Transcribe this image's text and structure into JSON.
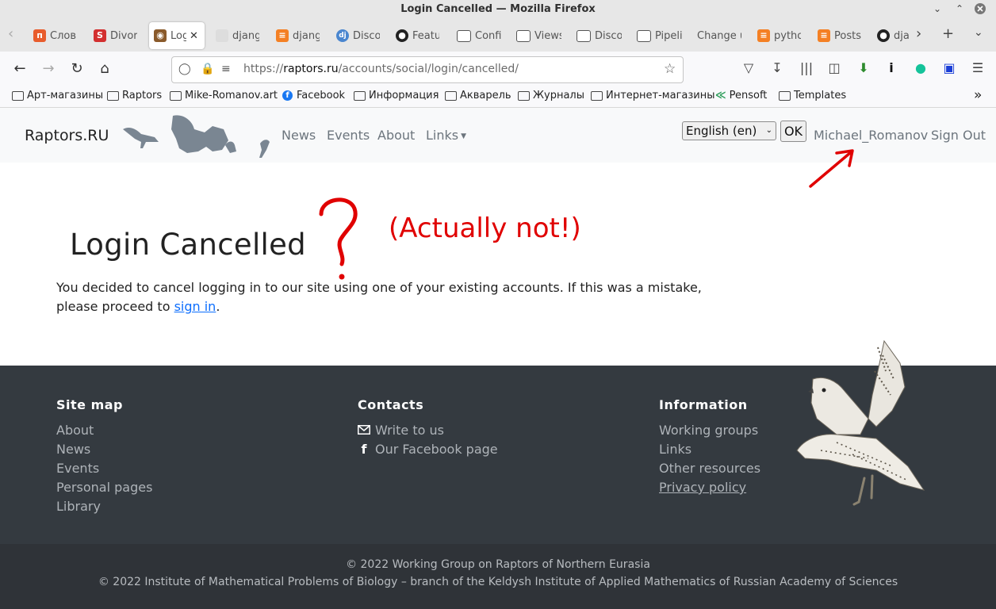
{
  "window": {
    "title": "Login Cancelled — Mozilla Firefox"
  },
  "tabs": [
    {
      "label": "Слов",
      "icon": "p-favicon",
      "color": "#e85c2c"
    },
    {
      "label": "Divor",
      "icon": "s-favicon",
      "color": "#d32f2f"
    },
    {
      "label": "Log",
      "icon": "owl-favicon",
      "color": "#8a5a2b",
      "active": true
    },
    {
      "label": "djang",
      "icon": "cube-favicon",
      "color": "#cccccc"
    },
    {
      "label": "djang",
      "icon": "stackoverflow-icon",
      "color": "#f48024"
    },
    {
      "label": "Disco",
      "icon": "dj-favicon",
      "color": "#4a86cf"
    },
    {
      "label": "Featu",
      "icon": "github-icon",
      "color": "#222222"
    },
    {
      "label": "Confi",
      "icon": "doc-icon",
      "color": "#555555"
    },
    {
      "label": "Views",
      "icon": "doc-icon",
      "color": "#555555"
    },
    {
      "label": "Disco",
      "icon": "doc-icon",
      "color": "#555555"
    },
    {
      "label": "Pipeli",
      "icon": "doc-icon",
      "color": "#555555"
    },
    {
      "label": "Change u",
      "icon": "none",
      "color": "#e7e7e7"
    },
    {
      "label": "pytho",
      "icon": "stackoverflow-icon",
      "color": "#f48024"
    },
    {
      "label": "Posts",
      "icon": "stackoverflow-icon",
      "color": "#f48024"
    },
    {
      "label": "dja",
      "icon": "github-icon",
      "color": "#222222"
    }
  ],
  "url": {
    "prefix": "https://",
    "host": "raptors.ru",
    "path": "/accounts/social/login/cancelled/"
  },
  "bookmarks": [
    {
      "label": "Арт-магазины",
      "icon": "folder-icon"
    },
    {
      "label": "Raptors",
      "icon": "folder-icon"
    },
    {
      "label": "Mike-Romanov.art",
      "icon": "folder-icon"
    },
    {
      "label": "Facebook",
      "icon": "facebook-icon"
    },
    {
      "label": "Информация",
      "icon": "folder-icon"
    },
    {
      "label": "Акварель",
      "icon": "folder-icon"
    },
    {
      "label": "Журналы",
      "icon": "folder-icon"
    },
    {
      "label": "Интернет-магазины",
      "icon": "folder-icon"
    },
    {
      "label": "Pensoft",
      "icon": "pensoft-icon"
    },
    {
      "label": "Templates",
      "icon": "folder-icon"
    }
  ],
  "site": {
    "brand": "Raptors.RU",
    "nav": {
      "news": "News",
      "events": "Events",
      "about": "About",
      "links": "Links"
    },
    "language": "English (en)",
    "ok": "OK",
    "user": "Michael_Romanov",
    "signout": "Sign Out"
  },
  "main": {
    "title": "Login Cancelled",
    "text_before": "You decided to cancel logging in to our site using one of your existing accounts. If this was a mistake, please proceed to ",
    "link": "sign in",
    "text_after": ".",
    "annotation": "(Actually not!)"
  },
  "footer": {
    "sitemap": {
      "title": "Site map",
      "links": [
        "About",
        "News",
        "Events",
        "Personal pages",
        "Library"
      ]
    },
    "contacts": {
      "title": "Contacts",
      "links": [
        "Write to us",
        "Our Facebook page"
      ]
    },
    "information": {
      "title": "Information",
      "links": [
        "Working groups",
        "Links",
        "Other resources",
        "Privacy policy"
      ]
    },
    "copyright1": "© 2022 Working Group on Raptors of Northern Eurasia",
    "copyright2": "© 2022 Institute of Mathematical Problems of Biology – branch of the Keldysh Institute of Applied Mathematics of Russian Academy of Sciences"
  },
  "colors": {
    "annotation": "#e00000",
    "footer_bg": "#343a40",
    "link": "#0d6efd"
  }
}
